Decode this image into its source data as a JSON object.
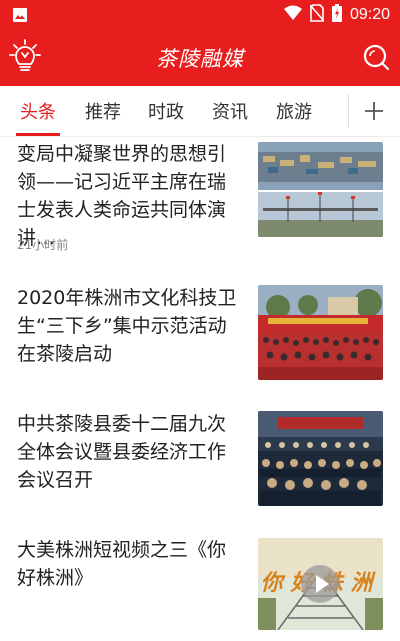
{
  "status_bar": {
    "time": "09:20"
  },
  "header": {
    "title": "茶陵融媒"
  },
  "tabs": [
    {
      "label": "头条",
      "active": true
    },
    {
      "label": "推荐",
      "active": false
    },
    {
      "label": "时政",
      "active": false
    },
    {
      "label": "资讯",
      "active": false
    },
    {
      "label": "旅游",
      "active": false
    }
  ],
  "news": [
    {
      "headline": "变局中凝聚世界的思想引领——记习近平主席在瑞士发表人类命运共同体演讲…",
      "time": "21小时前"
    },
    {
      "headline": "2020年株洲市文化科技卫生“三下乡”集中示范活动在茶陵启动"
    },
    {
      "headline": "中共茶陵县委十二届九次全体会议暨县委经济工作会议召开"
    },
    {
      "headline": "大美株洲短视频之三《你好株洲》",
      "thumb_text": "你好株洲"
    }
  ],
  "colors": {
    "brand_red": "#e81e1e",
    "text": "#222222",
    "muted": "#888888"
  }
}
